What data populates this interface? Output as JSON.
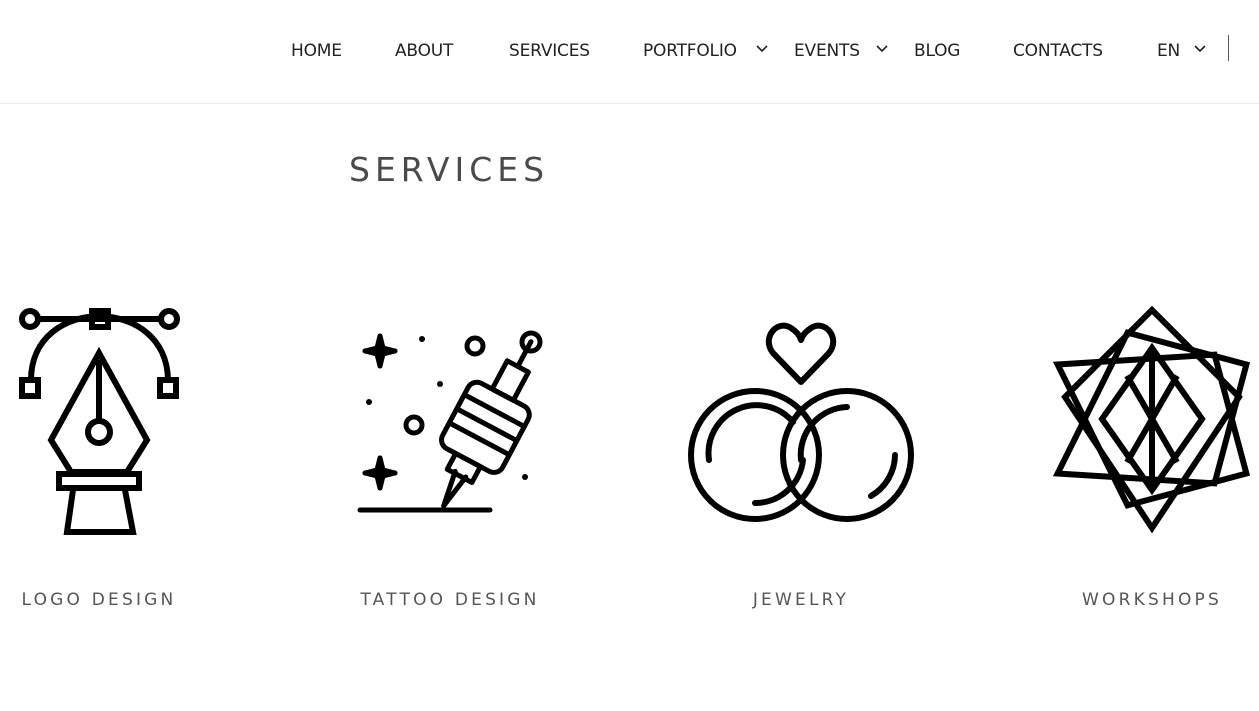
{
  "nav": {
    "items": [
      {
        "label": "HOME"
      },
      {
        "label": "ABOUT"
      },
      {
        "label": "SERVICES"
      },
      {
        "label": "PORTFOLIO",
        "has_dropdown": true
      },
      {
        "label": "EVENTS",
        "has_dropdown": true
      },
      {
        "label": "BLOG"
      },
      {
        "label": "CONTACTS"
      },
      {
        "label": "EN",
        "has_dropdown": true
      }
    ]
  },
  "section": {
    "title": "SERVICES",
    "services": [
      {
        "label": "LOGO DESIGN",
        "icon": "pen-tool-bezier-icon"
      },
      {
        "label": "TATTOO DESIGN",
        "icon": "tattoo-machine-icon"
      },
      {
        "label": "JEWELRY",
        "icon": "wedding-rings-icon"
      },
      {
        "label": "WORKSHOPS",
        "icon": "geometric-star-icon"
      }
    ]
  },
  "colors": {
    "text": "#222222",
    "label": "#555555",
    "icon_stroke": "#000000",
    "background": "#ffffff"
  }
}
